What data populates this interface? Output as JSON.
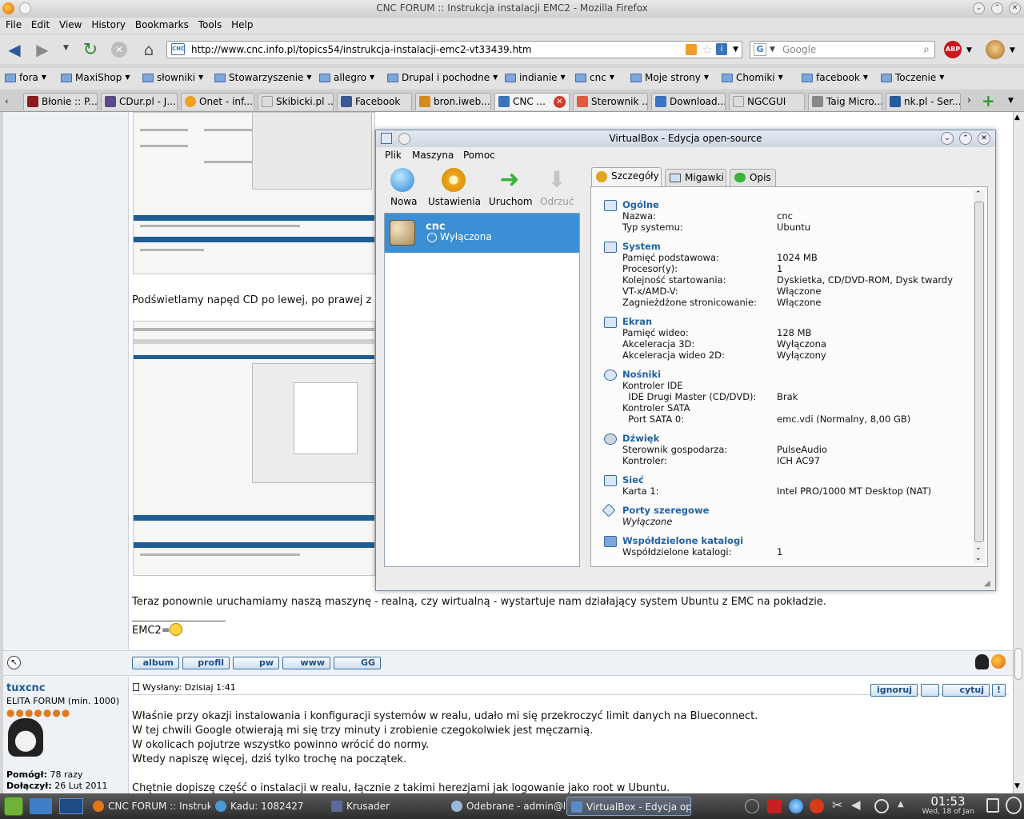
{
  "browser": {
    "window_title": "CNC FORUM :: Instrukcja instalacji EMC2 - Mozilla Firefox",
    "menu": [
      "File",
      "Edit",
      "View",
      "History",
      "Bookmarks",
      "Tools",
      "Help"
    ],
    "url": "http://www.cnc.info.pl/topics54/instrukcja-instalacji-emc2-vt33439.htm",
    "search_placeholder": "Google",
    "bookmarks": [
      "fora",
      "MaxiShop",
      "słowniki",
      "Stowarzyszenie",
      "allegro",
      "Drupal i pochodne",
      "indianie",
      "cnc",
      "Moje strony",
      "Chomiki",
      "facebook",
      "Toczenie"
    ],
    "tabs": [
      {
        "label": "Błonie :: P...",
        "color": "#8b1a1a"
      },
      {
        "label": "CDur.pl - J...",
        "color": "#5a4a8a"
      },
      {
        "label": "Onet - inf...",
        "color": "#f0a020"
      },
      {
        "label": "Skibicki.pl ...",
        "color": "#dcdcdc"
      },
      {
        "label": "Facebook",
        "color": "#3b5998"
      },
      {
        "label": "bron.iweb....",
        "color": "#d58a1c"
      },
      {
        "label": "CNC ...",
        "color": "#3a74b8"
      },
      {
        "label": "Sterownik ...",
        "color": "#e05a40"
      },
      {
        "label": "Download...",
        "color": "#3b74c0"
      },
      {
        "label": "NGCGUI",
        "color": "#dcdcdc"
      },
      {
        "label": "Taig Micro...",
        "color": "#888"
      },
      {
        "label": "nk.pl - Ser...",
        "color": "#2a5a9a"
      }
    ]
  },
  "forum": {
    "caption_partial": "Podświetlamy napęd CD po lewej, po prawej z rozw",
    "para1": "Teraz ponownie uruchamiamy naszą maszynę - realną, czy wirtualną - wystartuje nam działający system Ubuntu z EMC na pokładzie.",
    "sig_line": "__________________",
    "sig": "EMC2=",
    "post_buttons": [
      "album",
      "profil",
      "pw",
      "www",
      "GG"
    ],
    "post2": {
      "author": "tuxcnc",
      "rank": "ELITA FORUM (min. 1000)",
      "helped_label": "Pomógł:",
      "helped_value": "78 razy",
      "joined_label": "Dołączył:",
      "joined_value": "26 Lut 2011",
      "posted": "Wysłany: Dzisiaj 1:41",
      "actions": [
        "ignoruj",
        "",
        "cytuj"
      ],
      "lines": [
        "Właśnie przy okazji instalowania i konfiguracji systemów w realu, udało mi się przekroczyć limit danych na Blueconnect.",
        "W tej chwili Google otwierają mi się trzy minuty i zrobienie czegokolwiek jest męczarnią.",
        "W okolicach pojutrze wszystko powinno wrócić do normy.",
        "Wtedy napiszę więcej, dziś tylko trochę na początek.",
        "Chętnie dopiszę część o instalacji w realu, łącznie z takimi herezjami jak logowanie jako root w Ubuntu."
      ]
    }
  },
  "virtualbox": {
    "title": "VirtualBox - Edycja open-source",
    "menu": [
      "Plik",
      "Maszyna",
      "Pomoc"
    ],
    "toolbar": [
      "Nowa",
      "Ustawienia",
      "Uruchom",
      "Odrzuć"
    ],
    "vm": {
      "name": "cnc",
      "state": "Wyłączona"
    },
    "tabs": [
      "Szczegóły",
      "Migawki",
      "Opis"
    ],
    "sections": {
      "general": {
        "title": "Ogólne",
        "rows": [
          [
            "Nazwa:",
            "cnc"
          ],
          [
            "Typ systemu:",
            "Ubuntu"
          ]
        ]
      },
      "system": {
        "title": "System",
        "rows": [
          [
            "Pamięć podstawowa:",
            "1024 MB"
          ],
          [
            "Procesor(y):",
            "1"
          ],
          [
            "Kolejność startowania:",
            "Dyskietka, CD/DVD-ROM, Dysk twardy"
          ],
          [
            "VT-x/AMD-V:",
            "Włączone"
          ],
          [
            "Zagnieżdżone stronicowanie:",
            "Włączone"
          ]
        ]
      },
      "display": {
        "title": "Ekran",
        "rows": [
          [
            "Pamięć wideo:",
            "128 MB"
          ],
          [
            "Akceleracja 3D:",
            "Wyłączona"
          ],
          [
            "Akceleracja wideo 2D:",
            "Wyłączony"
          ]
        ]
      },
      "storage": {
        "title": "Nośniki",
        "rows": [
          [
            "Kontroler IDE",
            ""
          ],
          [
            "  IDE Drugi Master (CD/DVD):",
            "Brak"
          ],
          [
            "Kontroler SATA",
            ""
          ],
          [
            "  Port SATA 0:",
            "emc.vdi (Normalny, 8,00 GB)"
          ]
        ]
      },
      "audio": {
        "title": "Dźwięk",
        "rows": [
          [
            "Sterownik gospodarza:",
            "PulseAudio"
          ],
          [
            "Kontroler:",
            "ICH AC97"
          ]
        ]
      },
      "network": {
        "title": "Sieć",
        "rows": [
          [
            "Karta 1:",
            "Intel PRO/1000 MT Desktop (NAT)"
          ]
        ]
      },
      "serial": {
        "title": "Porty szeregowe",
        "rows": [
          [
            "Wyłączone",
            ""
          ]
        ]
      },
      "shared": {
        "title": "Współdzielone katalogi",
        "rows": [
          [
            "Współdzielone katalogi:",
            "1"
          ]
        ]
      }
    }
  },
  "taskbar": {
    "tasks": [
      "CNC FORUM :: Instrukcja",
      "Kadu: 1082427",
      "Krusader",
      "Odebrane - admin@blc",
      "VirtualBox - Edycja oper"
    ],
    "time": "01:53",
    "date": "Wed, 18 of Jan"
  },
  "colors": {
    "accent": "#3b8fd4",
    "link": "#2262a4",
    "forum_blue": "#1f5e94"
  }
}
